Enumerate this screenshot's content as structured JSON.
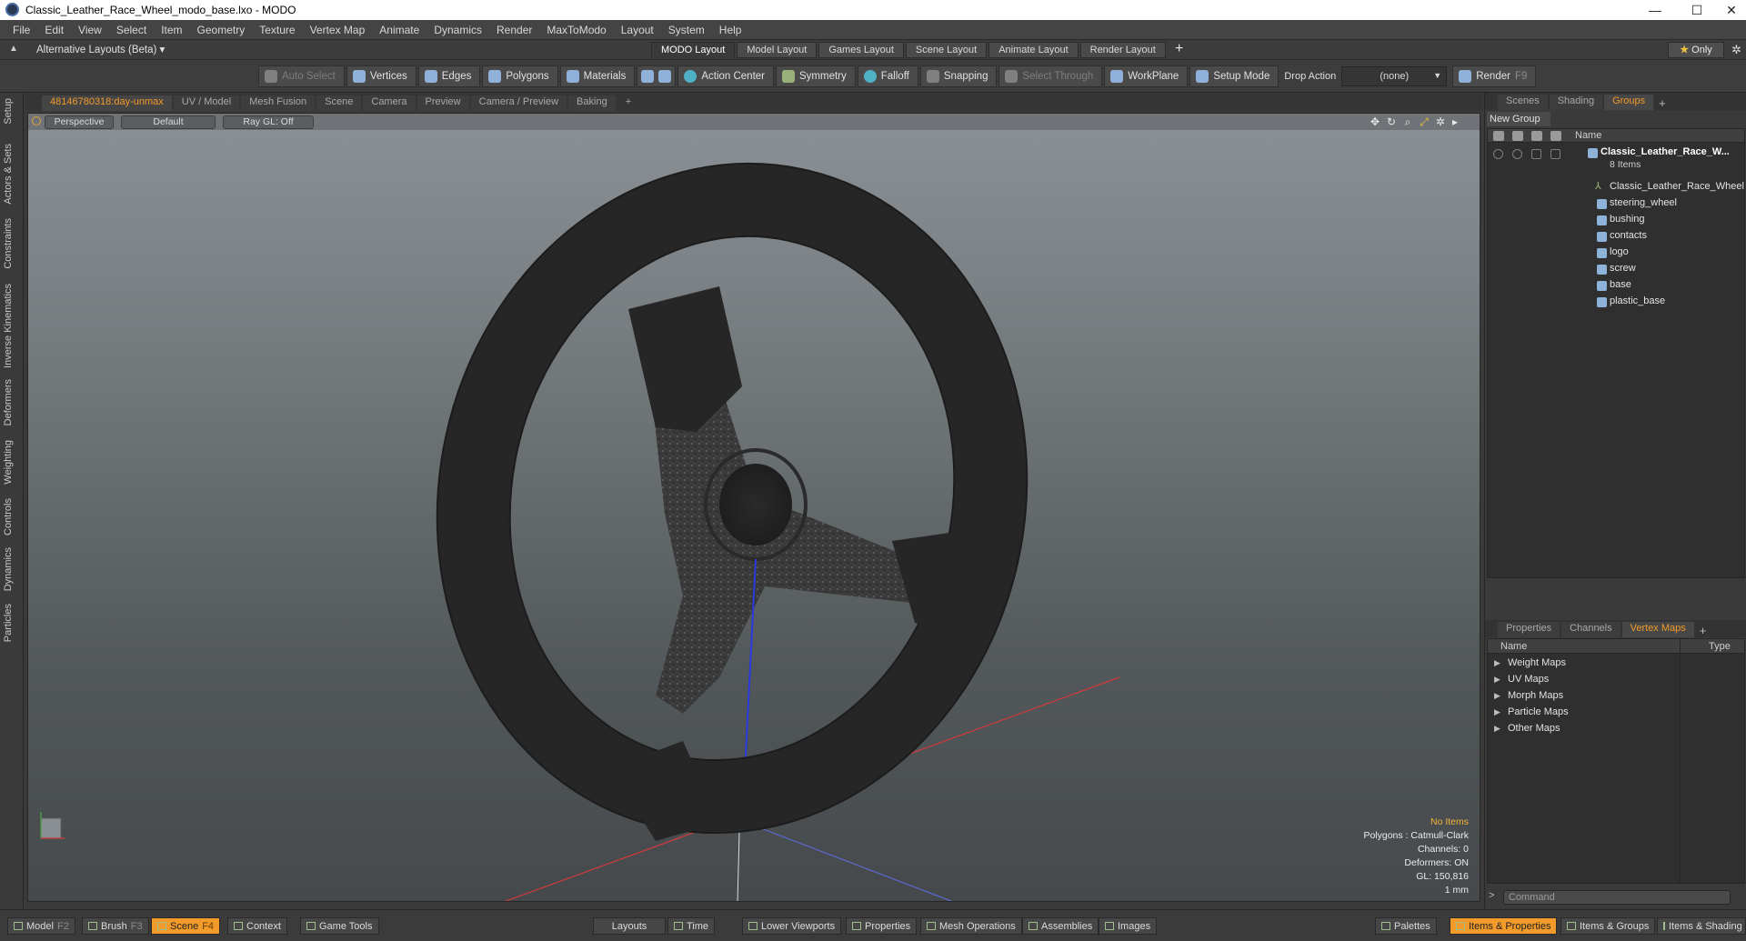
{
  "window": {
    "title": "Classic_Leather_Race_Wheel_modo_base.lxo - MODO",
    "controls": [
      "—",
      "☐",
      "✕"
    ]
  },
  "menu": [
    "File",
    "Edit",
    "View",
    "Select",
    "Item",
    "Geometry",
    "Texture",
    "Vertex Map",
    "Animate",
    "Dynamics",
    "Render",
    "MaxToModo",
    "Layout",
    "System",
    "Help"
  ],
  "layout_bar": {
    "alt_layouts": "Alternative Layouts (Beta) ▾",
    "tabs": [
      {
        "label": "MODO Layout",
        "active": true
      },
      {
        "label": "Model Layout"
      },
      {
        "label": "Games Layout"
      },
      {
        "label": "Scene Layout"
      },
      {
        "label": "Animate Layout"
      },
      {
        "label": "Render Layout"
      }
    ],
    "add": "+",
    "only_star": "★",
    "only_label": "Only"
  },
  "toolbar": {
    "auto_select": "Auto Select",
    "vertices": "Vertices",
    "edges": "Edges",
    "polygons": "Polygons",
    "materials": "Materials",
    "action_center": "Action Center",
    "symmetry": "Symmetry",
    "falloff": "Falloff",
    "snapping": "Snapping",
    "select_through": "Select Through",
    "workplane": "WorkPlane",
    "setup_mode": "Setup Mode",
    "drop_action_label": "Drop Action",
    "drop_action_value": "(none)",
    "render": "Render",
    "render_key": "F9"
  },
  "left_tabs": [
    "Setup",
    "Actors & Sets",
    "Constraints",
    "Inverse Kinematics",
    "Deformers",
    "Weighting",
    "Controls",
    "Dynamics",
    "Particles"
  ],
  "viewport_tabs": [
    {
      "label": "48146780318:day-unmax",
      "active": true
    },
    {
      "label": "UV / Model"
    },
    {
      "label": "Mesh Fusion"
    },
    {
      "label": "Scene"
    },
    {
      "label": "Camera"
    },
    {
      "label": "Preview"
    },
    {
      "label": "Camera / Preview"
    },
    {
      "label": "Baking"
    },
    {
      "label": "+"
    }
  ],
  "viewport": {
    "view": "Perspective",
    "style": "Default",
    "raygl": "Ray GL: Off",
    "stats": {
      "items": "No Items",
      "polygons": "Polygons : Catmull-Clark",
      "channels": "Channels: 0",
      "deformers": "Deformers: ON",
      "gl": "GL: 150,816",
      "unit": "1 mm"
    }
  },
  "scene_tabs": [
    {
      "label": "Scenes"
    },
    {
      "label": "Shading"
    },
    {
      "label": "Groups",
      "active": true
    }
  ],
  "groups": {
    "new_group": "New Group",
    "name_header": "Name",
    "root": {
      "name": "Classic_Leather_Race_W...",
      "count": "8 Items"
    },
    "items": [
      "Classic_Leather_Race_Wheel",
      "steering_wheel",
      "bushing",
      "contacts",
      "logo",
      "screw",
      "base",
      "plastic_base"
    ]
  },
  "props_tabs": [
    {
      "label": "Properties"
    },
    {
      "label": "Channels"
    },
    {
      "label": "Vertex Maps",
      "active": true
    }
  ],
  "vertex_maps": {
    "name_header": "Name",
    "type_header": "Type",
    "rows": [
      "Weight Maps",
      "UV Maps",
      "Morph Maps",
      "Particle Maps",
      "Other Maps"
    ]
  },
  "command_placeholder": "Command",
  "bottom_bar": {
    "model": "Model",
    "model_key": "F2",
    "brush": "Brush",
    "brush_key": "F3",
    "scene": "Scene",
    "scene_key": "F4",
    "context": "Context",
    "game_tools": "Game Tools",
    "layouts": "Layouts",
    "time": "Time",
    "lower_viewports": "Lower Viewports",
    "properties": "Properties",
    "mesh_operations": "Mesh Operations",
    "assemblies": "Assemblies",
    "images": "Images",
    "palettes": "Palettes",
    "items_properties": "Items & Properties",
    "items_groups": "Items & Groups",
    "items_shading": "Items & Shading"
  },
  "colors": {
    "accent": "#f29a2a",
    "viewport_top": "#8b9196",
    "viewport_bottom": "#45494c",
    "wheel": "#2b2b2b",
    "axis_x": "#d23a3a",
    "axis_y": "#4a7a3a",
    "axis_z": "#3a4ad2"
  }
}
